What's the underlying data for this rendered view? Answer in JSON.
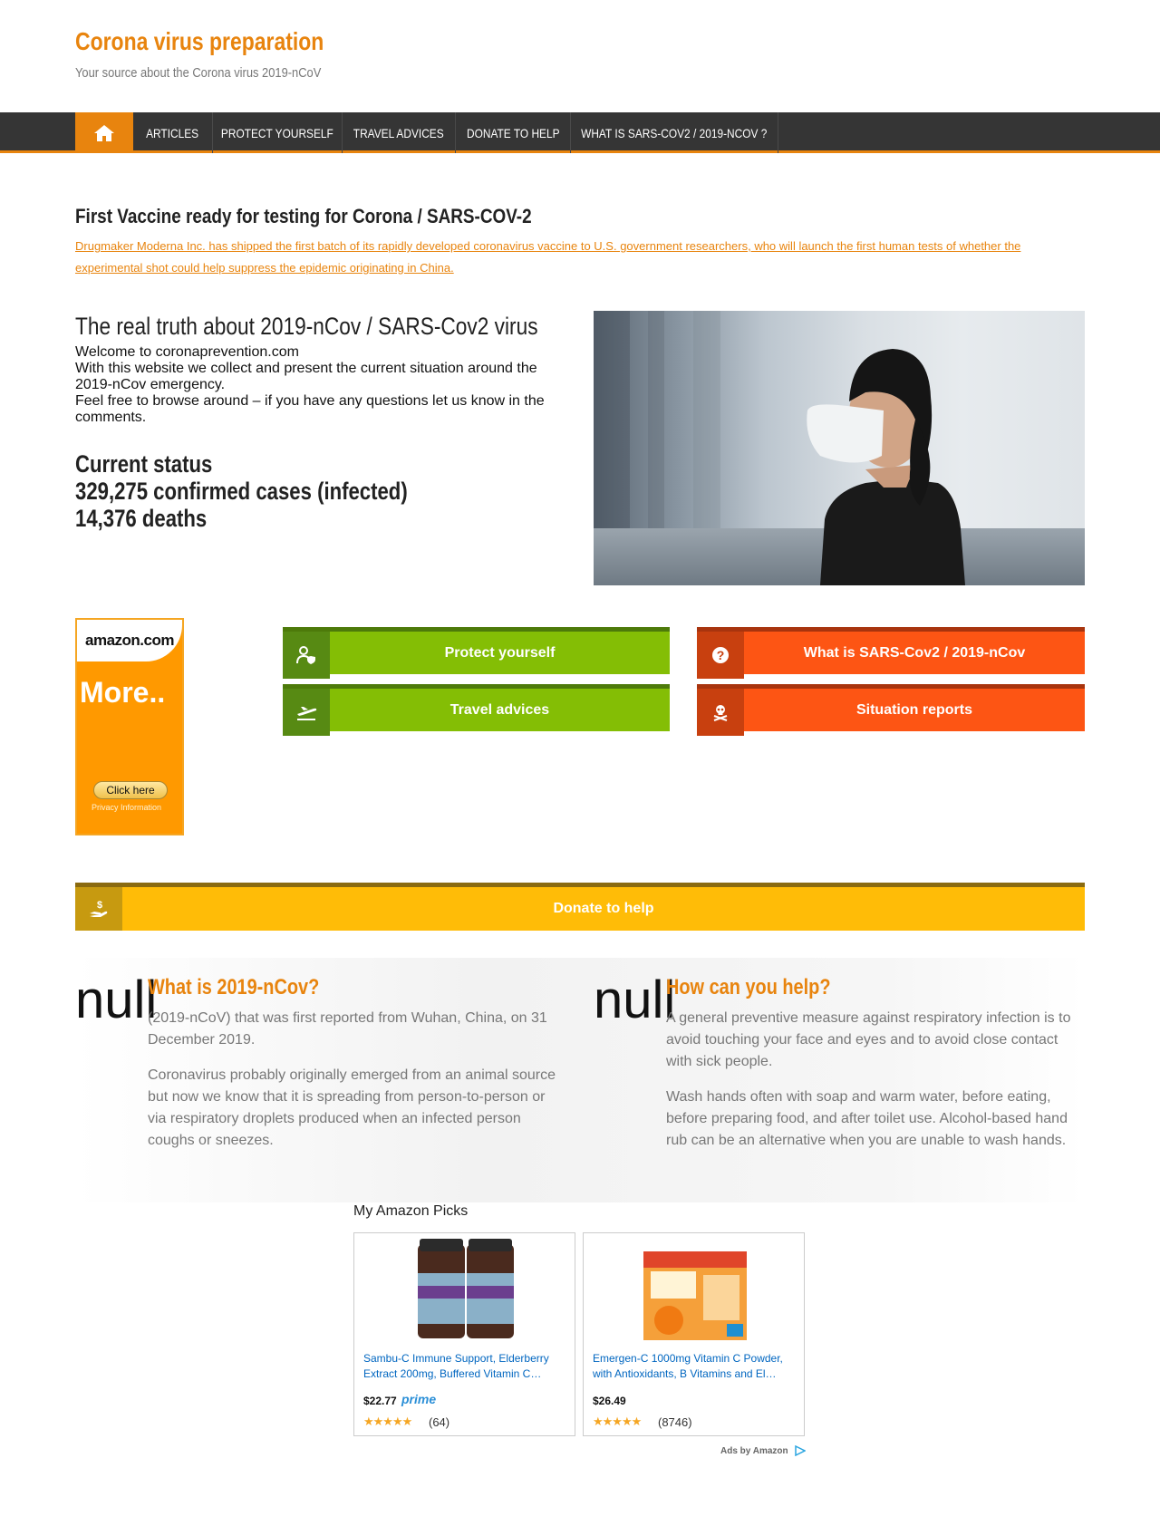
{
  "site": {
    "title": "Corona virus preparation",
    "description": "Your source about the Corona virus 2019-nCoV"
  },
  "nav": {
    "home_icon": "home-icon",
    "items": [
      "ARTICLES",
      "PROTECT YOURSELF",
      "TRAVEL ADVICES",
      "DONATE TO HELP",
      "WHAT IS SARS-COV2 / 2019-NCOV ?"
    ]
  },
  "vaccine": {
    "title": "First Vaccine ready for testing for Corona / SARS-COV-2",
    "link": "Drugmaker Moderna Inc. has shipped the first batch of its rapidly developed coronavirus vaccine to U.S. government researchers, who will launch the first human tests of whether the experimental shot could help suppress the epidemic originating in China."
  },
  "truth": {
    "title": "The real truth about 2019-nCov / SARS-Cov2 virus",
    "line1": "Welcome to coronaprevention.com",
    "line2": "With this website we collect and present the current situation around the 2019-nCov emergency.",
    "line3": "Feel free to browse around – if you have any questions let us know in the comments."
  },
  "status": {
    "heading": "Current status",
    "confirmed": "329,275 confirmed cases (infected)",
    "deaths": "14,376 deaths"
  },
  "amazon_ad": {
    "logo": "amazon.com",
    "more": "More..",
    "button": "Click here",
    "privacy": "Privacy Information"
  },
  "buttons": {
    "protect": "Protect yourself",
    "what_is": "What is SARS-Cov2 / 2019-nCov",
    "travel": "Travel advices",
    "situation": "Situation reports",
    "donate": "Donate to help"
  },
  "info": {
    "left": {
      "img_alt": "null",
      "title": "What is 2019-nCov?",
      "p1": "(2019-nCoV) that was first reported from Wuhan, China, on 31 December 2019.",
      "p2": "Coronavirus probably originally emerged from an animal source but now we know that it is spreading from person-to-person or via respiratory droplets produced when an infected person coughs or sneezes."
    },
    "right": {
      "img_alt": "null",
      "title": "How can you help?",
      "p1": "A general preventive measure against respiratory infection is to avoid touching your face and eyes and to avoid close contact with sick people.",
      "p2": "Wash hands often with soap and warm water, before eating, before preparing food, and after toilet use. Alcohol-based hand rub can be an alternative when you are unable to wash hands."
    }
  },
  "picks": {
    "title": "My Amazon Picks",
    "items": [
      {
        "name": "Sambu-C Immune Support, Elderberry Extract 200mg, Buffered Vitamin C…",
        "price": "$22.77",
        "prime": "prime",
        "reviews": "(64)"
      },
      {
        "name": "Emergen-C 1000mg Vitamin C Powder, with Antioxidants, B Vitamins and El…",
        "price": "$26.49",
        "prime": "",
        "reviews": "(8746)"
      }
    ],
    "ads_by": "Ads by Amazon"
  },
  "colors": {
    "accent": "#e8840e",
    "green": "#84be05",
    "orange": "#fd5514",
    "yellow": "#ffbc07",
    "nav": "#353535"
  }
}
